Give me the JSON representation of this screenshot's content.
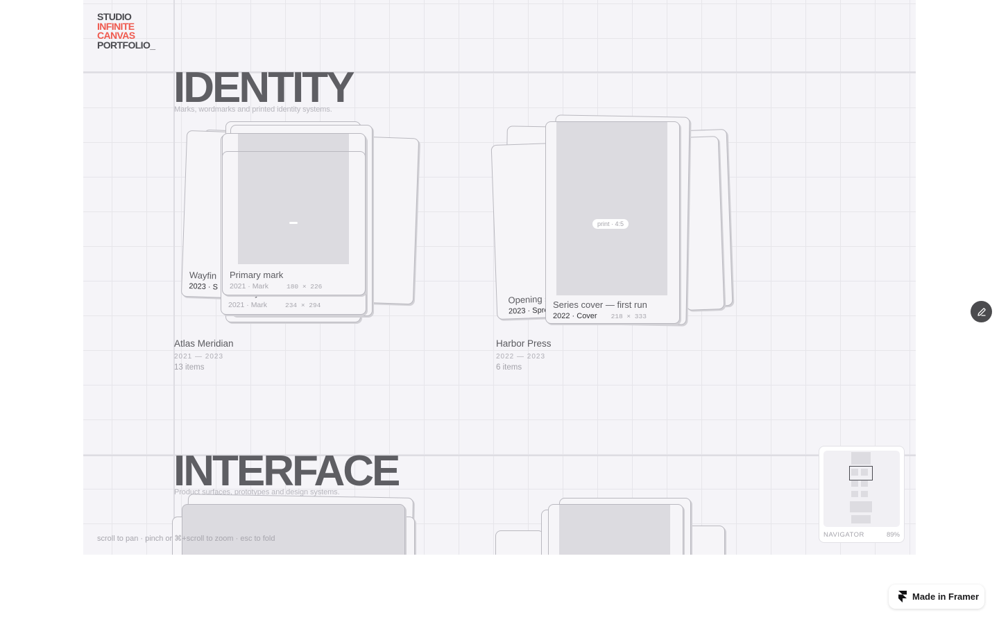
{
  "logo": {
    "line1": "STUDIO",
    "line2": "INFINITE",
    "line3": "CANVAS",
    "line4": "PORTFOLIO_"
  },
  "sections": [
    {
      "title": "IDENTITY",
      "subtitle": "Marks, wordmarks and printed identity systems."
    },
    {
      "title": "INTERFACE",
      "subtitle": "Product surfaces, prototypes and design systems."
    }
  ],
  "groups": [
    {
      "name": "Atlas Meridian",
      "years": "2021 — 2023",
      "count": "13 items",
      "back_card": {
        "title": "Wayfin",
        "meta": "2023 · S"
      },
      "mid_card": {
        "title": "Primary mark",
        "meta": "2021 · Mark",
        "dims": "234 × 294"
      },
      "front_card": {
        "title": "Primary mark",
        "meta": "2021 · Mark",
        "dims": "180 × 226"
      }
    },
    {
      "name": "Harbor Press",
      "years": "2022 — 2023",
      "count": "6 items",
      "back_card": {
        "title": "Opening s",
        "meta": "2023 · Spre"
      },
      "front_card": {
        "title": "Series cover — first run",
        "meta": "2022 · Cover",
        "dims": "218 × 333",
        "badge": "print · 4:5"
      }
    }
  ],
  "hint": "scroll to pan · pinch or ⌘+scroll to zoom · esc to fold",
  "navigator": {
    "label": "NAVIGATOR",
    "zoom": "89%"
  },
  "framer": {
    "label": "Made in Framer"
  },
  "icons": {
    "edit": "pencil-icon",
    "framer": "framer-logo-icon"
  }
}
